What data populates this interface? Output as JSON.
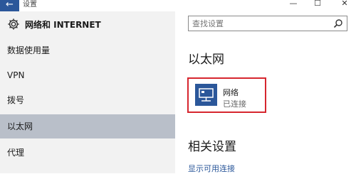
{
  "window": {
    "title": "设置",
    "back_symbol": "←",
    "minimize_symbol": "—",
    "maximize_symbol": "☐",
    "close_symbol": "✕"
  },
  "sidebar": {
    "header_icon": "gear-icon",
    "header_title": "网络和 INTERNET",
    "items": [
      {
        "label": "数据使用量",
        "active": false
      },
      {
        "label": "VPN",
        "active": false
      },
      {
        "label": "拨号",
        "active": false
      },
      {
        "label": "以太网",
        "active": true
      },
      {
        "label": "代理",
        "active": false
      }
    ]
  },
  "search": {
    "placeholder": "查找设置",
    "icon": "search-icon"
  },
  "main": {
    "section_title": "以太网",
    "network": {
      "icon": "ethernet-icon",
      "name": "网络",
      "status": "已连接",
      "highlight_color": "#d6262e"
    },
    "related_title": "相关设置",
    "related_link": "显示可用连接"
  },
  "colors": {
    "accent": "#2b579a",
    "active_nav": "#b9bfc9",
    "sidebar_bg": "#f2f2f2"
  }
}
